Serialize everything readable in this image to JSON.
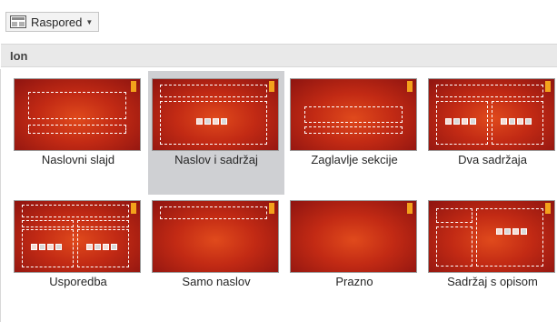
{
  "toolbar": {
    "layout_label": "Raspored",
    "layout_icon": "layout-icon",
    "chevron_icon": "chevron-down-icon"
  },
  "group": {
    "title": "Ion"
  },
  "colors": {
    "accent": "#f3a21b",
    "slide_red": "#c22a14",
    "selected_bg": "#cfd0d3"
  },
  "layouts": [
    {
      "label": "Naslovni slajd",
      "selected": false
    },
    {
      "label": "Naslov i sadržaj",
      "selected": true
    },
    {
      "label": "Zaglavlje sekcije",
      "selected": false
    },
    {
      "label": "Dva sadržaja",
      "selected": false
    },
    {
      "label": "Usporedba",
      "selected": false
    },
    {
      "label": "Samo naslov",
      "selected": false
    },
    {
      "label": "Prazno",
      "selected": false
    },
    {
      "label": "Sadržaj s opisom",
      "selected": false
    }
  ]
}
